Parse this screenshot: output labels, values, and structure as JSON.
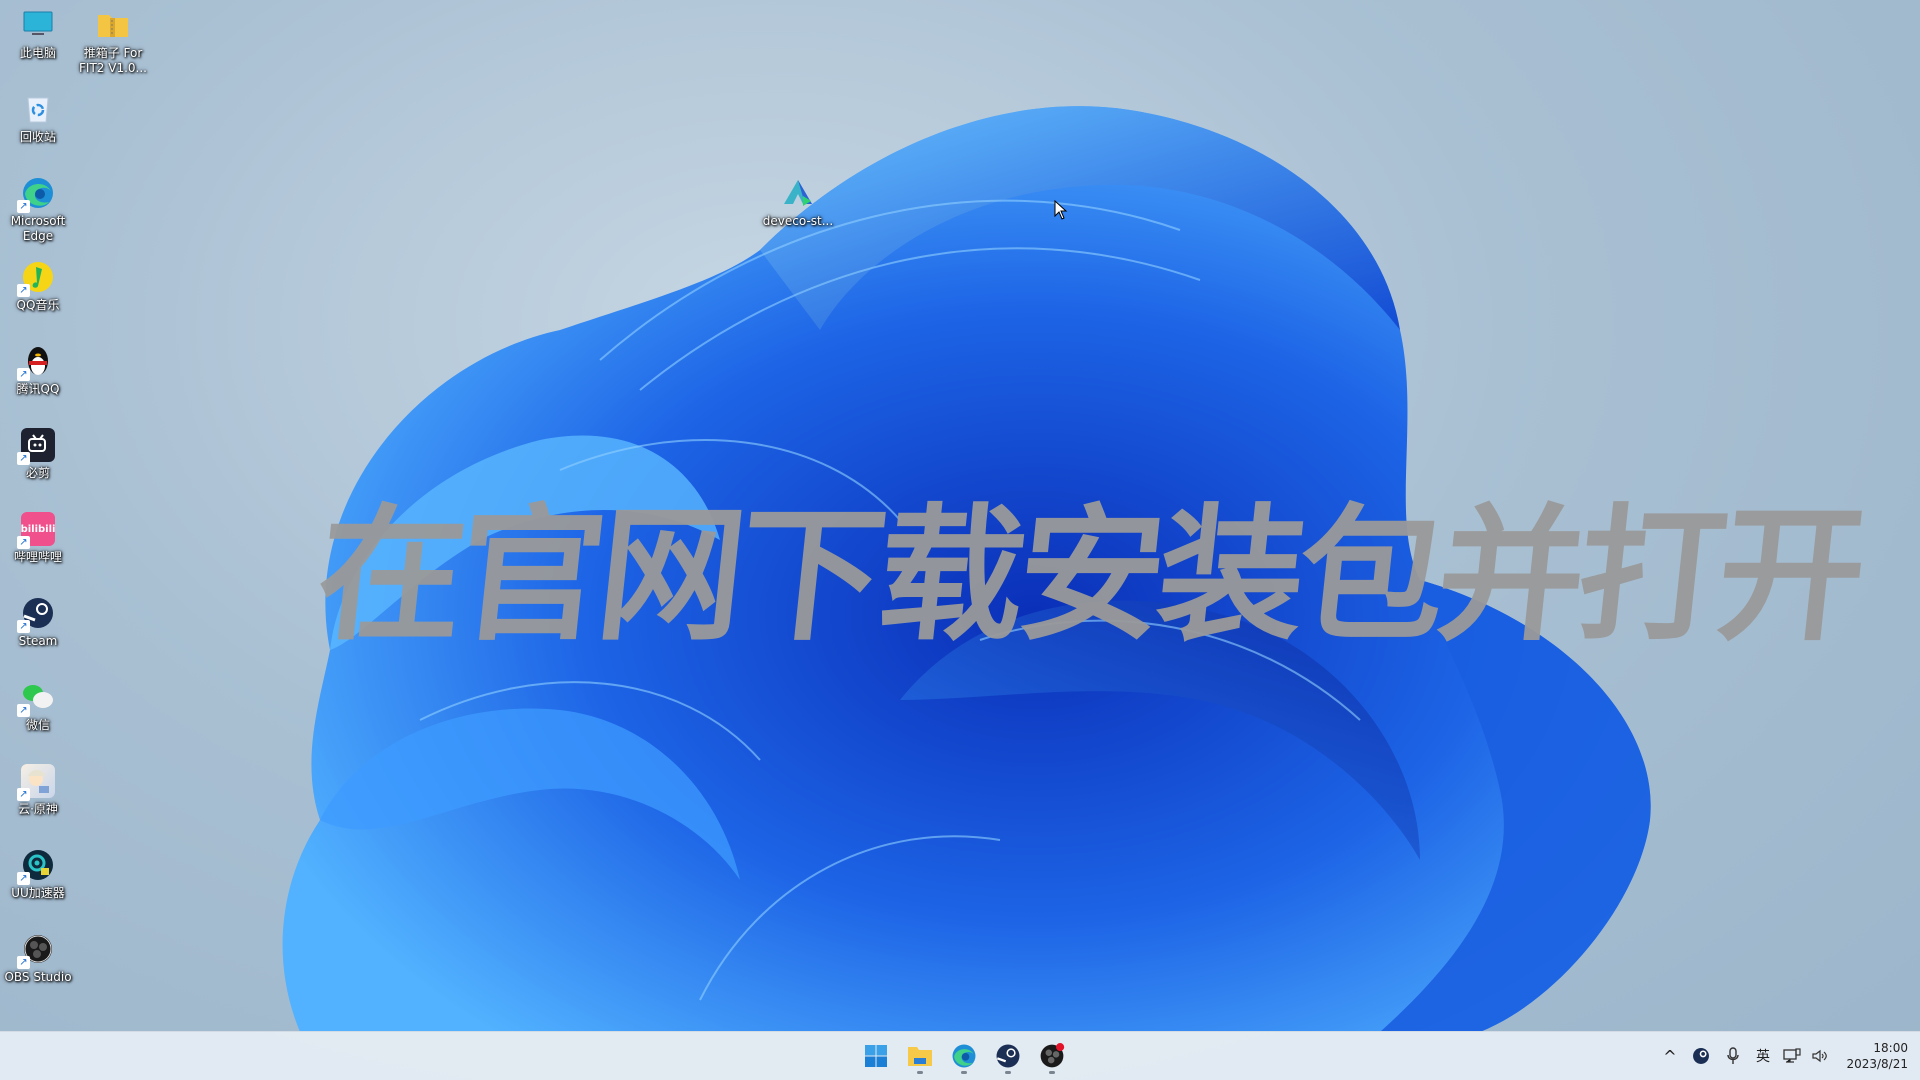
{
  "desktop": {
    "icons": [
      {
        "label": "此电脑",
        "icon": "computer-icon"
      },
      {
        "label": "推箱子 For\nFIT2 V1.0...",
        "icon": "zip-folder-icon"
      },
      {
        "label": "回收站",
        "icon": "recycle-bin-icon"
      },
      {
        "label": "Microsoft\nEdge",
        "icon": "edge-icon"
      },
      {
        "label": "QQ音乐",
        "icon": "qq-music-icon"
      },
      {
        "label": "腾讯QQ",
        "icon": "qq-penguin-icon"
      },
      {
        "label": "必剪",
        "icon": "bcut-icon"
      },
      {
        "label": "哔哩哔哩",
        "icon": "bilibili-icon"
      },
      {
        "label": "Steam",
        "icon": "steam-icon"
      },
      {
        "label": "微信",
        "icon": "wechat-icon"
      },
      {
        "label": "云·原神",
        "icon": "genshin-cloud-icon"
      },
      {
        "label": "UU加速器",
        "icon": "uu-accelerator-icon"
      },
      {
        "label": "OBS Studio",
        "icon": "obs-icon"
      },
      {
        "label": "deveco-st...",
        "icon": "deveco-studio-icon"
      }
    ]
  },
  "overlay": {
    "caption": "在官网下载安装包并打开"
  },
  "taskbar": {
    "pinned": [
      {
        "name": "Start",
        "icon": "windows-start-icon"
      },
      {
        "name": "File Explorer",
        "icon": "file-explorer-icon"
      },
      {
        "name": "Microsoft Edge",
        "icon": "edge-icon"
      },
      {
        "name": "Steam",
        "icon": "steam-icon"
      },
      {
        "name": "OBS Studio",
        "icon": "obs-icon"
      }
    ],
    "tray": {
      "show_hidden": "^",
      "input_language": "英",
      "time": "18:00",
      "date": "2023/8/21"
    }
  },
  "colors": {
    "accent": "#1a73e8",
    "bloom_dark": "#0b3fc7",
    "bloom_light": "#4fb3ff",
    "caption": "#9a9a9a"
  }
}
